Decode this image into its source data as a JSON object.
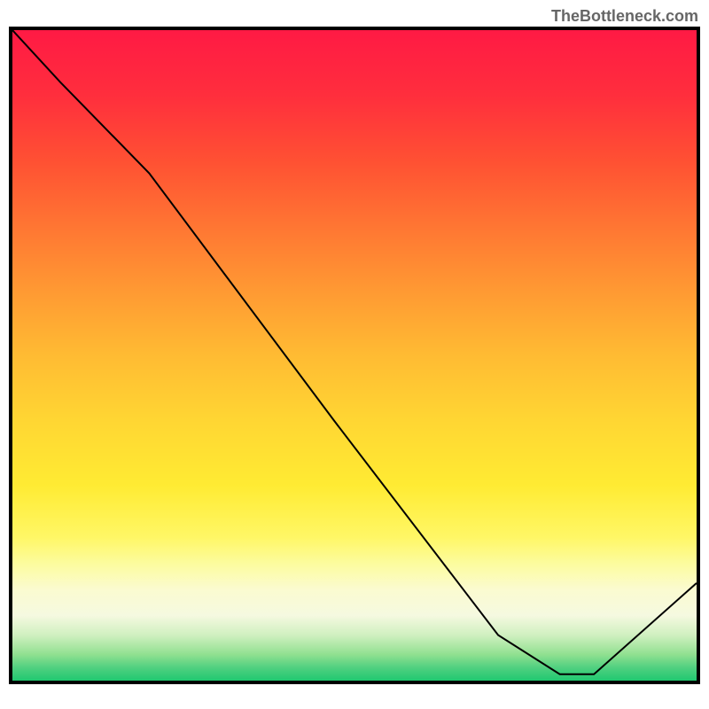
{
  "watermark": "TheBottleneck.com",
  "annotation_text": "",
  "chart_data": {
    "type": "line",
    "title": "",
    "xlabel": "",
    "ylabel": "",
    "x": [
      0.0,
      0.07,
      0.2,
      0.47,
      0.71,
      0.8,
      0.85,
      1.0
    ],
    "values": [
      1.0,
      0.92,
      0.78,
      0.4,
      0.07,
      0.01,
      0.01,
      0.15
    ],
    "ylim": [
      0,
      1
    ],
    "xlim": [
      0,
      1
    ],
    "annotation_position": {
      "x": 0.78,
      "y": 0.01
    },
    "background": "rainbow-gradient-red-to-green"
  }
}
